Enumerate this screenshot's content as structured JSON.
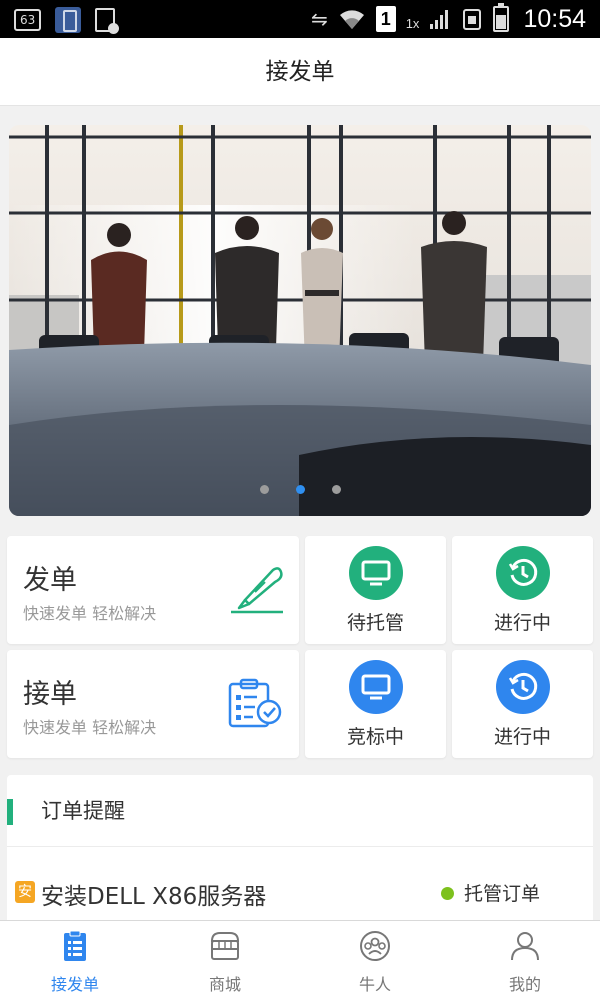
{
  "status_bar": {
    "badge": "63",
    "network": "1",
    "network_type": "1x",
    "time": "10:54"
  },
  "header": {
    "title": "接发单"
  },
  "banner": {
    "dots": 3,
    "active_dot": 2
  },
  "quick": {
    "send": {
      "title": "发单",
      "subtitle": "快速发单 轻松解决",
      "icon": "pen-icon"
    },
    "receive": {
      "title": "接单",
      "subtitle": "快速发单 轻松解决",
      "icon": "clipboard-checklist-icon"
    },
    "pending_custody": {
      "label": "待托管",
      "icon": "monitor-icon",
      "color": "#22b07d"
    },
    "in_progress_green": {
      "label": "进行中",
      "icon": "clock-history-icon",
      "color": "#22b07d"
    },
    "bidding": {
      "label": "竞标中",
      "icon": "monitor-icon",
      "color": "#2f86ee"
    },
    "in_progress_blue": {
      "label": "进行中",
      "icon": "clock-history-icon",
      "color": "#2f86ee"
    }
  },
  "orders": {
    "title": "订单提醒",
    "accent": "#22b07d",
    "items": [
      {
        "tag": "安",
        "name": "安装DELL X86服务器",
        "status": "托管订单",
        "status_color": "#7dc11d"
      }
    ]
  },
  "tabbar": {
    "active_color": "#2f86ee",
    "tabs": [
      {
        "label": "接发单",
        "icon": "list-icon",
        "active": true
      },
      {
        "label": "商城",
        "icon": "store-icon",
        "active": false
      },
      {
        "label": "牛人",
        "icon": "people-circle-icon",
        "active": false
      },
      {
        "label": "我的",
        "icon": "user-icon",
        "active": false
      }
    ]
  }
}
